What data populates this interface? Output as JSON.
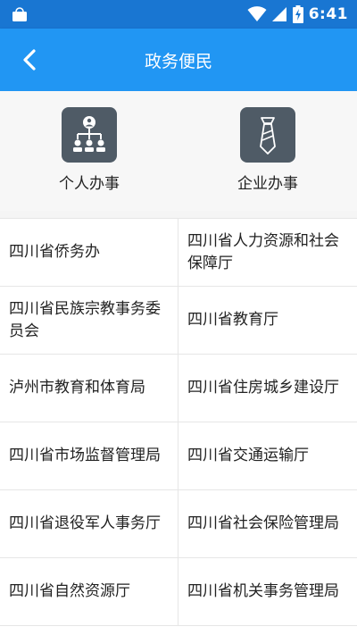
{
  "status_bar": {
    "time": "6:41",
    "icons": [
      "store-icon",
      "wifi-icon",
      "signal-icon",
      "battery-charging-icon"
    ]
  },
  "header": {
    "title": "政务便民",
    "back_icon": "chevron-left-icon"
  },
  "categories": [
    {
      "label": "个人办事",
      "icon": "org-chart-icon"
    },
    {
      "label": "企业办事",
      "icon": "tie-icon"
    }
  ],
  "departments": [
    "四川省侨务办",
    "四川省人力资源和社会保障厅",
    "四川省民族宗教事务委员会",
    "四川省教育厅",
    "泸州市教育和体育局",
    "四川省住房城乡建设厅",
    "四川省市场监督管理局",
    "四川省交通运输厅",
    "四川省退役军人事务厅",
    "四川省社会保险管理局",
    "四川省自然资源厅",
    "四川省机关事务管理局"
  ],
  "colors": {
    "status_bar": "#1976d2",
    "app_bar": "#2196f3",
    "icon_tile": "#4f5b66"
  }
}
